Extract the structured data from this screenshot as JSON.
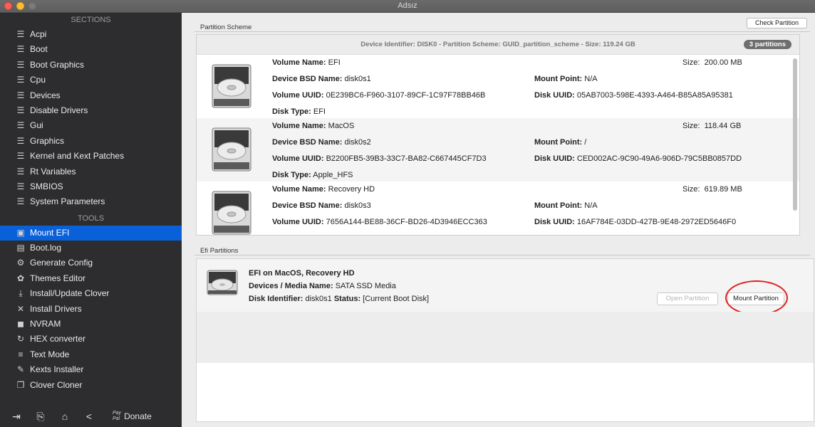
{
  "window": {
    "title": "Adsız"
  },
  "sidebar": {
    "sections_header": "SECTIONS",
    "sections": [
      {
        "label": "Acpi",
        "icon": "list-icon"
      },
      {
        "label": "Boot",
        "icon": "list-icon"
      },
      {
        "label": "Boot Graphics",
        "icon": "list-icon"
      },
      {
        "label": "Cpu",
        "icon": "list-icon"
      },
      {
        "label": "Devices",
        "icon": "list-icon"
      },
      {
        "label": "Disable Drivers",
        "icon": "list-icon"
      },
      {
        "label": "Gui",
        "icon": "list-icon"
      },
      {
        "label": "Graphics",
        "icon": "list-icon"
      },
      {
        "label": "Kernel and Kext Patches",
        "icon": "list-icon"
      },
      {
        "label": "Rt Variables",
        "icon": "list-icon"
      },
      {
        "label": "SMBIOS",
        "icon": "list-icon"
      },
      {
        "label": "System Parameters",
        "icon": "list-icon"
      }
    ],
    "tools_header": "TOOLS",
    "tools": [
      {
        "label": "Mount EFI",
        "icon": "drive-icon",
        "active": true
      },
      {
        "label": "Boot.log",
        "icon": "log-icon"
      },
      {
        "label": "Generate Config",
        "icon": "gears-icon"
      },
      {
        "label": "Themes Editor",
        "icon": "palette-icon"
      },
      {
        "label": "Install/Update Clover",
        "icon": "download-icon"
      },
      {
        "label": "Install Drivers",
        "icon": "wrench-icon"
      },
      {
        "label": "NVRAM",
        "icon": "chip-icon"
      },
      {
        "label": "HEX converter",
        "icon": "refresh-icon"
      },
      {
        "label": "Text Mode",
        "icon": "text-lines-icon"
      },
      {
        "label": "Kexts Installer",
        "icon": "puzzle-icon"
      },
      {
        "label": "Clover Cloner",
        "icon": "copy-icon"
      }
    ],
    "bottom": {
      "pay_top": "Pay",
      "pay_bottom": "Pal",
      "donate_label": "Donate"
    }
  },
  "main": {
    "check_partition_label": "Check Partition",
    "partition_scheme_label": "Partition Scheme",
    "device_header": "Device Identifier: DISK0 - Partition Scheme: GUID_partition_scheme - Size: 119.24 GB",
    "partitions_badge": "3 partitions",
    "volumes": [
      {
        "volume_name_label": "Volume Name:",
        "volume_name": "EFI",
        "size_label": "Size:",
        "size": "200.00 MB",
        "bsd_label": "Device BSD Name:",
        "bsd": "disk0s1",
        "mount_label": "Mount Point:",
        "mount": "N/A",
        "uuid_label": "Volume UUID:",
        "uuid": "0E239BC6-F960-3107-89CF-1C97F78BB46B",
        "disk_uuid_label": "Disk UUID:",
        "disk_uuid": "05AB7003-598E-4393-A464-B85A85A95381",
        "type_label": "Disk Type:",
        "type": "EFI"
      },
      {
        "volume_name_label": "Volume Name:",
        "volume_name": "MacOS",
        "size_label": "Size:",
        "size": "118.44 GB",
        "bsd_label": "Device BSD Name:",
        "bsd": "disk0s2",
        "mount_label": "Mount Point:",
        "mount": "/",
        "uuid_label": "Volume UUID:",
        "uuid": "B2200FB5-39B3-33C7-BA82-C667445CF7D3",
        "disk_uuid_label": "Disk UUID:",
        "disk_uuid": "CED002AC-9C90-49A6-906D-79C5BB0857DD",
        "type_label": "Disk Type:",
        "type": "Apple_HFS"
      },
      {
        "volume_name_label": "Volume Name:",
        "volume_name": "Recovery HD",
        "size_label": "Size:",
        "size": "619.89 MB",
        "bsd_label": "Device BSD Name:",
        "bsd": "disk0s3",
        "mount_label": "Mount Point:",
        "mount": "N/A",
        "uuid_label": "Volume UUID:",
        "uuid": "7656A144-BE88-36CF-BD26-4D3946ECC363",
        "disk_uuid_label": "Disk UUID:",
        "disk_uuid": "16AF784E-03DD-427B-9E48-2972ED5646F0"
      }
    ],
    "efi_partitions_label": "Efi Partitions",
    "efi": {
      "title": "EFI on MacOS, Recovery HD",
      "media_label": "Devices / Media Name:",
      "media": "SATA SSD Media",
      "disk_id_label": "Disk Identifier:",
      "disk_id": "disk0s1",
      "status_label": "Status:",
      "status": "[Current Boot Disk]",
      "open_partition_label": "Open Partition",
      "mount_partition_label": "Mount Partition"
    },
    "colors": {
      "accent": "#0a60d8",
      "highlight_circle": "#e02020",
      "sidebar_bg": "#2d2d2f"
    }
  }
}
